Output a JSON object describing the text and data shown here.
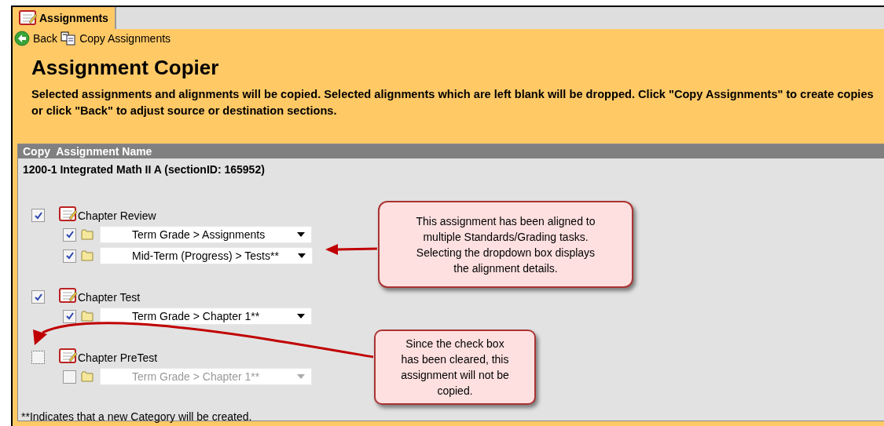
{
  "tab": {
    "label": "Assignments",
    "selected": true
  },
  "toolbar": [
    {
      "kind": "back",
      "label": "Back"
    },
    {
      "kind": "copy",
      "label": "Copy Assignments"
    }
  ],
  "title": "Assignment Copier",
  "description": "Selected assignments and alignments will be copied. Selected alignments which are left blank will be dropped. Click \"Copy Assignments\" to create copies or click \"Back\" to adjust source or destination sections.",
  "table": {
    "columns": [
      "Copy",
      "Assignment Name"
    ],
    "section": "1200-1 Integrated Math II A (sectionID: 165952)",
    "assignments": [
      {
        "name": "Chapter Review",
        "checked": true,
        "alignments": [
          {
            "checked": true,
            "value": "Term Grade > Assignments",
            "disabled": false
          },
          {
            "checked": true,
            "value": "Mid-Term (Progress) > Tests**",
            "disabled": false
          }
        ]
      },
      {
        "name": "Chapter Test",
        "checked": true,
        "alignments": [
          {
            "checked": true,
            "value": "Term Grade > Chapter 1**",
            "disabled": false
          }
        ]
      },
      {
        "name": "Chapter PreTest",
        "checked": false,
        "alignments": [
          {
            "checked": false,
            "value": "Term Grade > Chapter 1**",
            "disabled": true
          }
        ]
      }
    ],
    "footnote": "**Indicates that a new Category will be created."
  },
  "callouts": [
    {
      "text": "This assignment has been aligned to multiple Standards/Grading tasks. Selecting the dropdown box displays the alignment details."
    },
    {
      "text": "Since the check box has been cleared, this assignment will not be copied."
    }
  ]
}
